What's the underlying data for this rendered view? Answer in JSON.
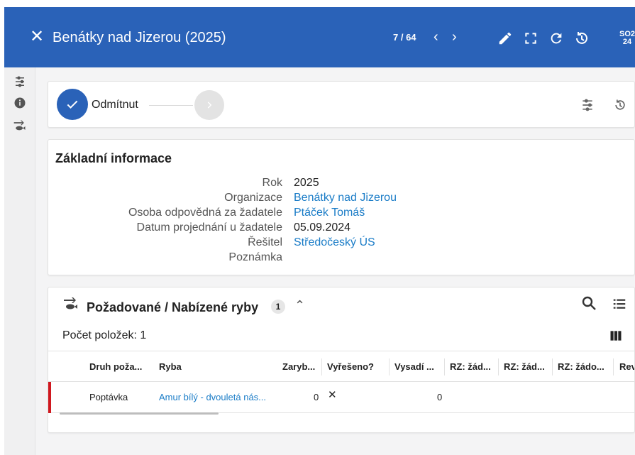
{
  "header": {
    "title": "Benátky nad Jizerou (2025)",
    "pager": "7 / 64",
    "close_icon": "close-icon",
    "code_line1": "SO2",
    "code_line2": "24",
    "tools": [
      "edit-icon",
      "fullscreen-icon",
      "refresh-icon",
      "history-icon"
    ],
    "background": "#2a62b8"
  },
  "sidebar": {
    "items": [
      "workflow-icon",
      "info-icon",
      "fish-icon"
    ]
  },
  "status": {
    "current_step": "Odmítnut",
    "accent": "#2a62b8"
  },
  "basic_info": {
    "title": "Základní informace",
    "rows": [
      {
        "label": "Rok",
        "value": "2025",
        "link": false
      },
      {
        "label": "Organizace",
        "value": "Benátky nad Jizerou",
        "link": true
      },
      {
        "label": "Osoba odpovědná za žadatele",
        "value": "Ptáček Tomáš",
        "link": true
      },
      {
        "label": "Datum projednání u žadatele",
        "value": "05.09.2024",
        "link": false
      },
      {
        "label": "Řešitel",
        "value": "Středočeský ÚS",
        "link": true
      },
      {
        "label": "Poznámka",
        "value": "",
        "link": false
      }
    ]
  },
  "fish_section": {
    "title": "Požadované / Nabízené ryby",
    "count_badge": "1",
    "items_count": "Počet položek: 1",
    "columns": [
      "Druh poža...",
      "Ryba",
      "Zaryb...",
      "Vyřešeno?",
      "Vysadí ...",
      "RZ: žád...",
      "RZ: žád...",
      "RZ: žádo...",
      "Rev"
    ],
    "rows": [
      {
        "druh": "Poptávka",
        "ryba": "Amur bílý - dvouletá nás...",
        "zaryb": "0",
        "vyreseno": "✕",
        "vysadi": "0",
        "marker_color": "#d0181f"
      }
    ]
  }
}
